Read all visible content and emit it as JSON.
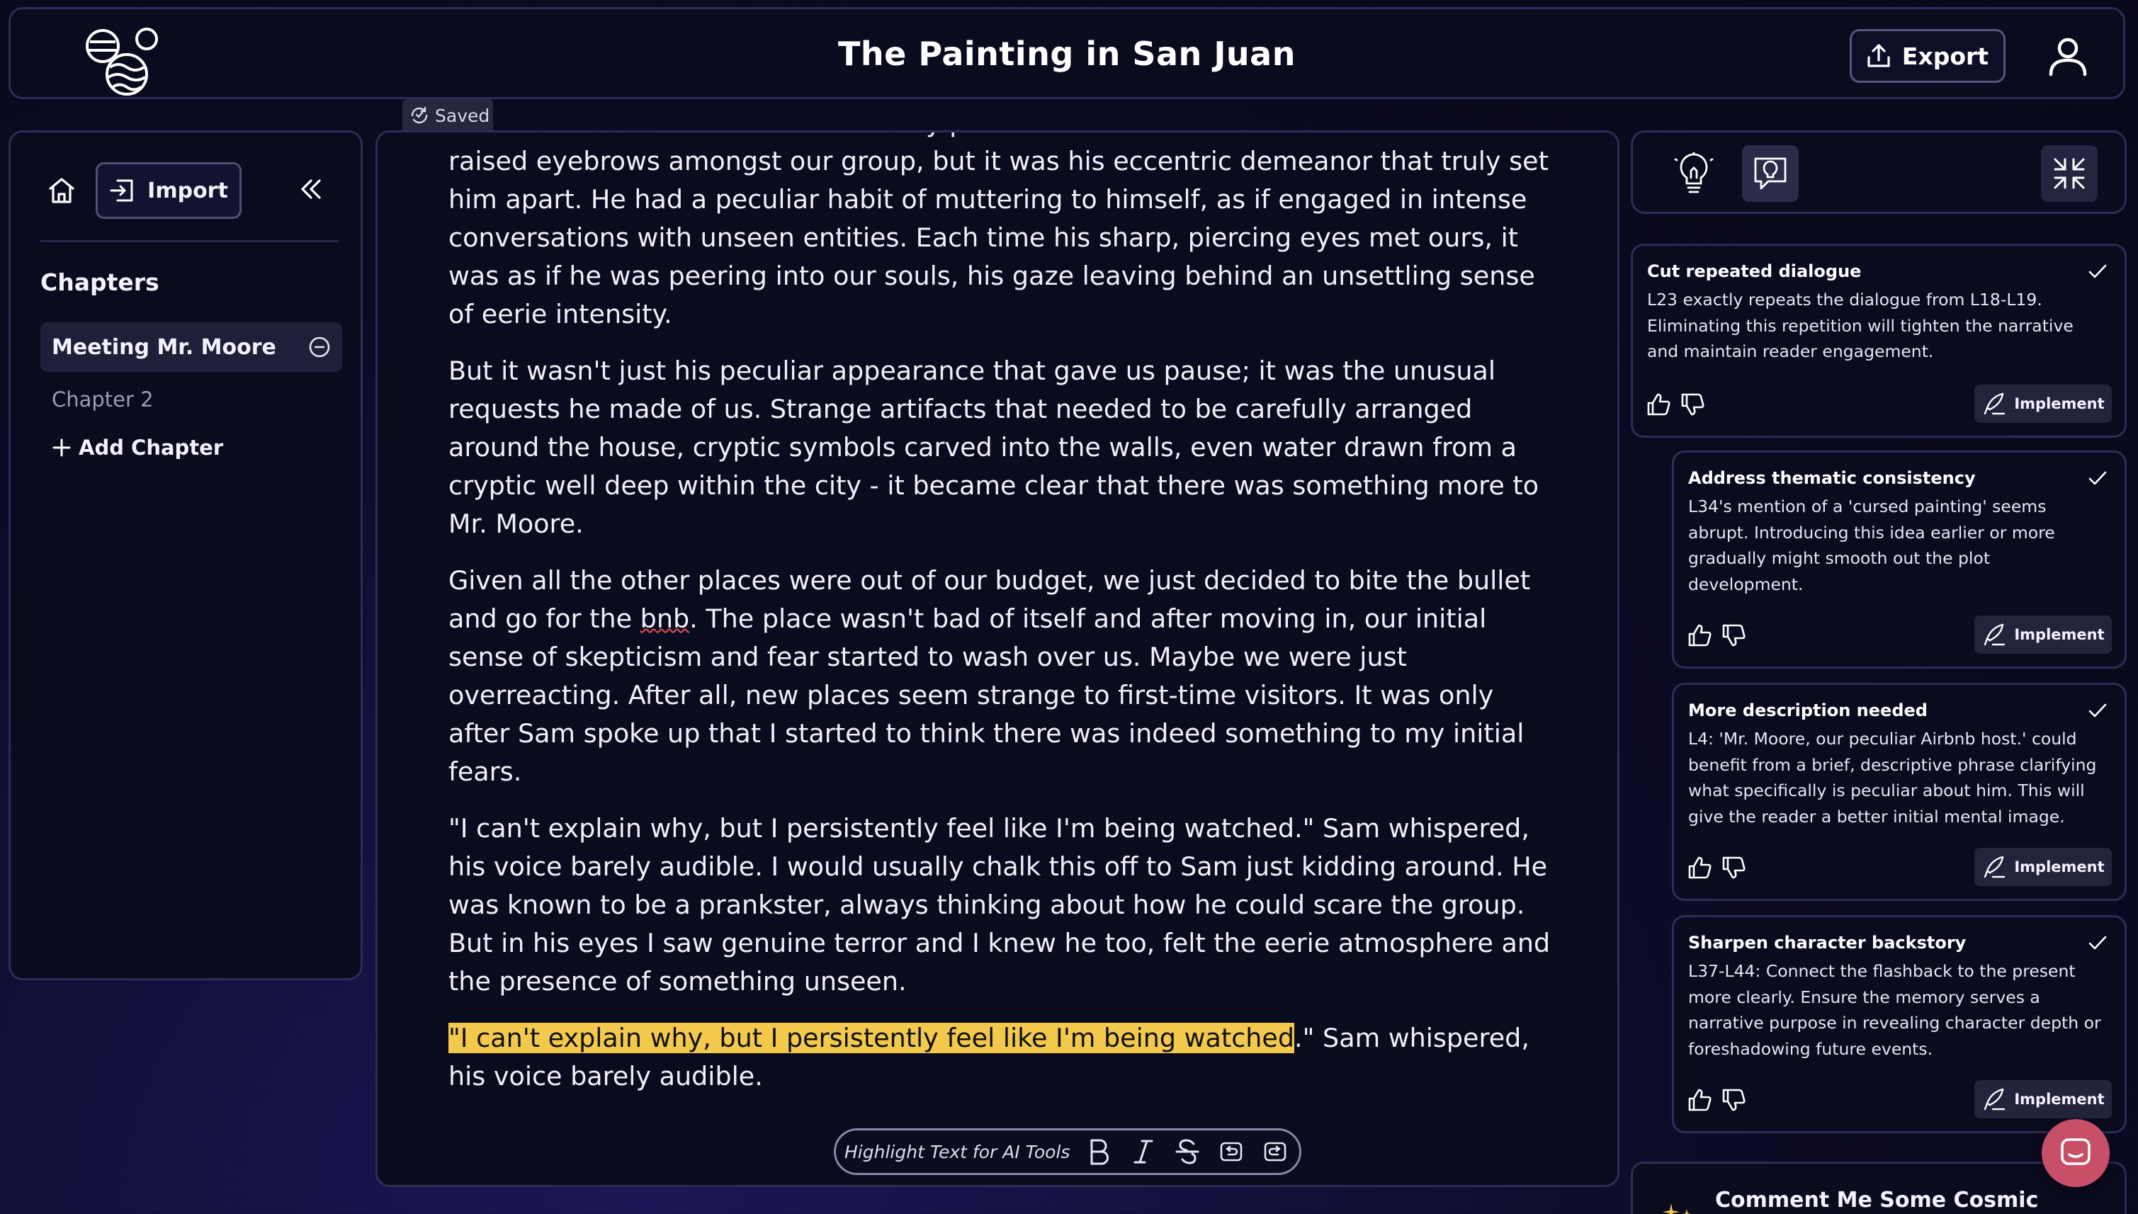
{
  "header": {
    "title": "The Painting in San Juan",
    "export_label": "Export"
  },
  "status": {
    "saved_label": "Saved"
  },
  "sidebar": {
    "import_label": "Import",
    "chapters_heading": "Chapters",
    "chapters": [
      {
        "label": "Meeting Mr. Moore",
        "active": true
      },
      {
        "label": "Chapter 2",
        "active": false
      }
    ],
    "add_chapter_label": "Add Chapter"
  },
  "editor": {
    "paragraphs": {
      "p0_cutoff": "that seemed to radiate from his every pore. His mismatched clothes and wild hair",
      "p0_rest": "raised eyebrows amongst our group, but it was his eccentric demeanor that truly set him apart. He had a peculiar habit of muttering to himself, as if engaged in intense conversations with unseen entities. Each time his sharp, piercing eyes met ours, it was as if he was peering into our souls, his gaze leaving behind an unsettling sense of eerie intensity.",
      "p1": "But it wasn't just his peculiar appearance that gave us pause; it was the unusual requests he made of us. Strange artifacts that needed to be carefully arranged around the house, cryptic symbols carved into the walls, even water drawn from a cryptic well deep within the city - it became clear that there was something more to Mr. Moore.",
      "p2_before": "Given all the other places were out of our budget, we just decided to bite the bullet and go for the ",
      "p2_misspelled": "bnb",
      "p2_after": ". The place wasn't bad of itself and after moving in, our initial sense of skepticism and fear started to wash over us. Maybe we were just overreacting. After all, new places seem strange to first-time visitors. It was only after Sam spoke up that I started to think there was indeed something to my initial fears.",
      "p3": "\"I can't explain why, but I persistently feel like I'm being watched.\" Sam whispered, his voice barely audible. I would usually chalk this off to Sam just kidding around. He was known to be a prankster, always thinking about how he could scare the group. But in his eyes I saw genuine terror and I knew he too, felt the eerie atmosphere and the presence of something unseen.",
      "p4_highlight": "\"I can't explain why, but I persistently feel like I'm being watched",
      "p4_rest": ".\" Sam whispered, his voice barely audible."
    },
    "format_bar": {
      "hint": "Highlight Text for AI Tools"
    }
  },
  "suggestions": [
    {
      "title": "Cut repeated dialogue",
      "body": "L23 exactly repeats the dialogue from L18-L19. Eliminating this repetition will tighten the narrative and maintain reader engagement.",
      "implement_label": "Implement"
    },
    {
      "title": "Address thematic consistency",
      "body": "L34's mention of a 'cursed painting' seems abrupt. Introducing this idea earlier or more gradually might smooth out the plot development.",
      "implement_label": "Implement"
    },
    {
      "title": "More description needed",
      "body": "L4: 'Mr. Moore, our peculiar Airbnb host.' could benefit from a brief, descriptive phrase clarifying what specifically is peculiar about him. This will give the reader a better initial mental image.",
      "implement_label": "Implement"
    },
    {
      "title": "Sharpen character backstory",
      "body": "L37-L44: Connect the flashback to the present more clearly. Ensure the memory serves a narrative purpose in revealing character depth or foreshadowing future events.",
      "implement_label": "Implement"
    }
  ],
  "critique": {
    "title": "Comment Me Some Cosmic Critique"
  },
  "colors": {
    "background": "#0b0a22",
    "panel_border": "#2c2d55",
    "highlight": "#f2c94c",
    "chat_button": "#c84f68"
  },
  "icons": [
    "logo-icon",
    "export-icon",
    "user-icon",
    "saved-icon",
    "home-icon",
    "import-icon",
    "collapse-icon",
    "remove-chapter-icon",
    "plus-icon",
    "bold-icon",
    "italic-icon",
    "strikethrough-icon",
    "undo-icon",
    "redo-icon",
    "lightbulb-icon",
    "comment-icon",
    "minimize-icon",
    "check-icon",
    "thumbs-up-icon",
    "thumbs-down-icon",
    "quill-icon",
    "sparkle-icon",
    "chat-icon"
  ]
}
